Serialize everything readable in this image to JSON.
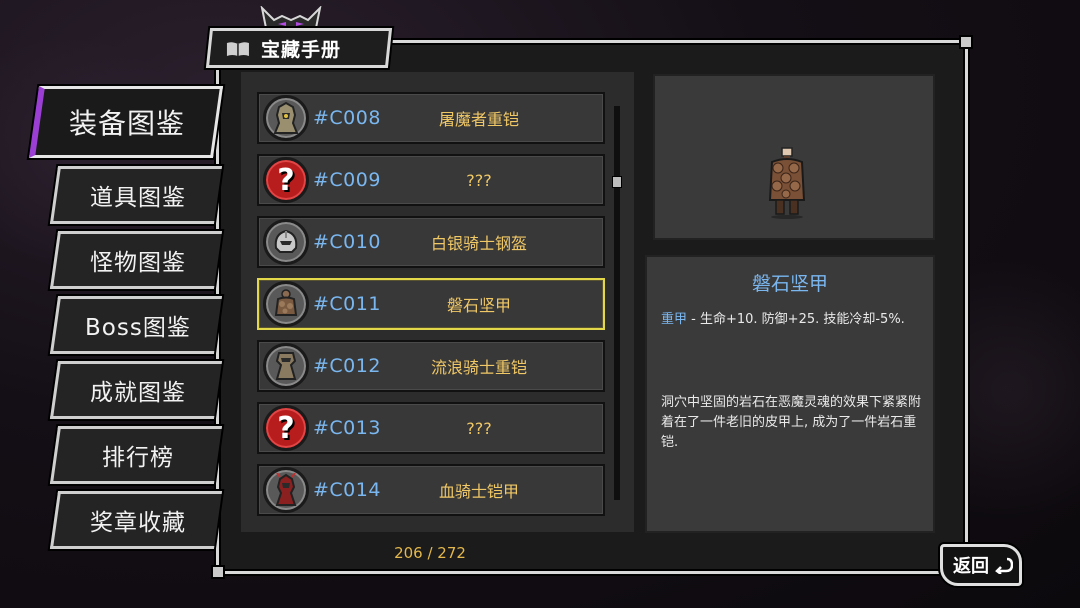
{
  "header": {
    "title": "宝藏手册"
  },
  "nav": {
    "items": [
      {
        "label": "装备图鉴",
        "active": true
      },
      {
        "label": "道具图鉴",
        "active": false
      },
      {
        "label": "怪物图鉴",
        "active": false
      },
      {
        "label": "Boss图鉴",
        "active": false
      },
      {
        "label": "成就图鉴",
        "active": false
      },
      {
        "label": "排行榜",
        "active": false
      },
      {
        "label": "奖章收藏",
        "active": false
      }
    ]
  },
  "list": {
    "rows": [
      {
        "code": "#C008",
        "name": "屠魔者重铠",
        "icon": "armor-icon",
        "known": true
      },
      {
        "code": "#C009",
        "name": "???",
        "icon": "question-icon",
        "known": false
      },
      {
        "code": "#C010",
        "name": "白银骑士钢盔",
        "icon": "helmet-icon",
        "known": true
      },
      {
        "code": "#C011",
        "name": "磐石坚甲",
        "icon": "stone-armor-icon",
        "known": true,
        "selected": true
      },
      {
        "code": "#C012",
        "name": "流浪骑士重铠",
        "icon": "armor-icon",
        "known": true
      },
      {
        "code": "#C013",
        "name": "???",
        "icon": "question-icon",
        "known": false
      },
      {
        "code": "#C014",
        "name": "血骑士铠甲",
        "icon": "blood-armor-icon",
        "known": true
      }
    ],
    "unknown_mark": "?",
    "page_count": "206 / 272"
  },
  "detail": {
    "title": "磐石坚甲",
    "type": "重甲",
    "stats": " - 生命+10. 防御+25. 技能冷却-5%.",
    "lore": "洞穴中坚固的岩石在恶魔灵魂的效果下紧紧附着在了一件老旧的皮甲上, 成为了一件岩石重铠."
  },
  "back": {
    "label": "返回",
    "icon": "return-arrow-icon"
  },
  "colors": {
    "accent_purple": "#9b3fd4",
    "code_blue": "#7ab7f0",
    "name_gold": "#f0c866",
    "selected_border": "#e2d84a"
  }
}
